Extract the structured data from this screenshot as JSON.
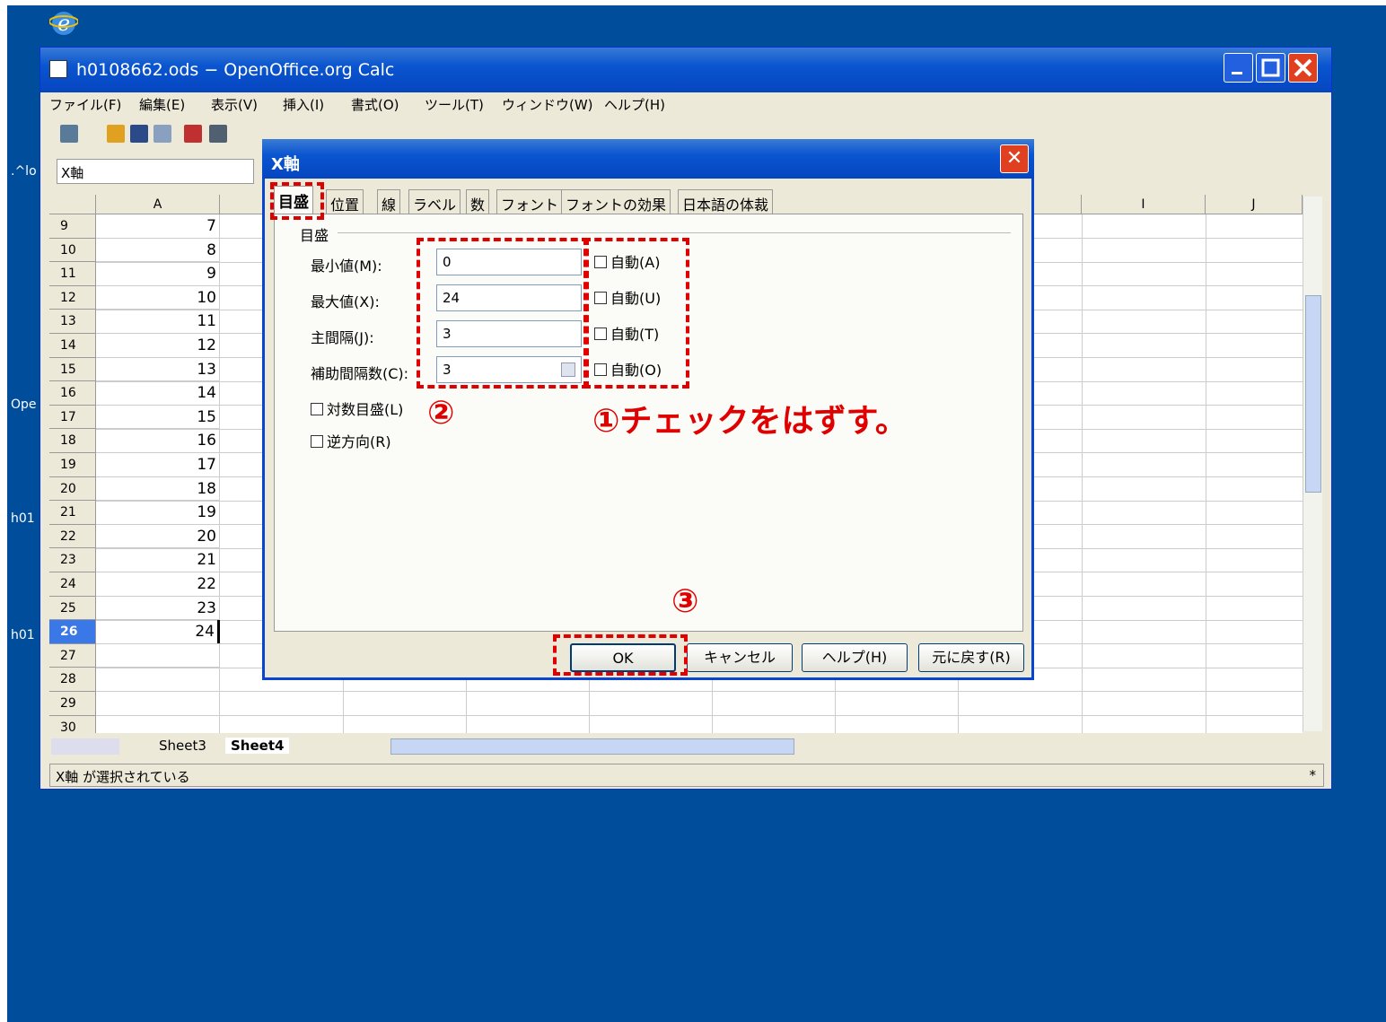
{
  "desktop": {
    "left_labels": [
      ".^lo",
      "Ope",
      "h01",
      "h01"
    ]
  },
  "window": {
    "title": "h0108662.ods − OpenOffice.org Calc",
    "menu": [
      "ファイル(F)",
      "編集(E)",
      "表示(V)",
      "挿入(I)",
      "書式(O)",
      "ツール(T)",
      "ウィンドウ(W)",
      "ヘルプ(H)"
    ],
    "name_box": "X軸"
  },
  "sheet": {
    "columns": [
      "A",
      "I",
      "J"
    ],
    "rows": [
      {
        "num": "9",
        "a": "7"
      },
      {
        "num": "10",
        "a": "8"
      },
      {
        "num": "11",
        "a": "9"
      },
      {
        "num": "12",
        "a": "10"
      },
      {
        "num": "13",
        "a": "11"
      },
      {
        "num": "14",
        "a": "12"
      },
      {
        "num": "15",
        "a": "13"
      },
      {
        "num": "16",
        "a": "14"
      },
      {
        "num": "17",
        "a": "15"
      },
      {
        "num": "18",
        "a": "16"
      },
      {
        "num": "19",
        "a": "17"
      },
      {
        "num": "20",
        "a": "18"
      },
      {
        "num": "21",
        "a": "19"
      },
      {
        "num": "22",
        "a": "20"
      },
      {
        "num": "23",
        "a": "21"
      },
      {
        "num": "24",
        "a": "22"
      },
      {
        "num": "25",
        "a": "23"
      },
      {
        "num": "26",
        "a": "24"
      },
      {
        "num": "27",
        "a": ""
      },
      {
        "num": "28",
        "a": ""
      },
      {
        "num": "29",
        "a": ""
      },
      {
        "num": "30",
        "a": ""
      }
    ],
    "selected_row": "26",
    "tabs": [
      "Sheet3",
      "Sheet4"
    ],
    "status": "X軸 が選択されている",
    "status_right": "*"
  },
  "dialog": {
    "title": "X軸",
    "close": "✕",
    "tabs": [
      "目盛",
      "位置",
      "線",
      "ラベル",
      "数",
      "フォント",
      "フォントの効果",
      "日本語の体裁"
    ],
    "group": "目盛",
    "fields": [
      {
        "label": "最小値(M):",
        "value": "0",
        "auto": "自動(A)"
      },
      {
        "label": "最大値(X):",
        "value": "24",
        "auto": "自動(U)"
      },
      {
        "label": "主間隔(J):",
        "value": "3",
        "auto": "自動(T)"
      },
      {
        "label": "補助間隔数(C):",
        "value": "3",
        "auto": "自動(O)"
      }
    ],
    "log_scale": "対数目盛(L)",
    "reverse": "逆方向(R)",
    "buttons": {
      "ok": "OK",
      "cancel": "キャンセル",
      "help": "ヘルプ(H)",
      "reset": "元に戻す(R)"
    }
  },
  "annotations": {
    "step1": "①チェックをはずす。",
    "step2": "②",
    "step3": "③",
    "color": "#e00000"
  }
}
